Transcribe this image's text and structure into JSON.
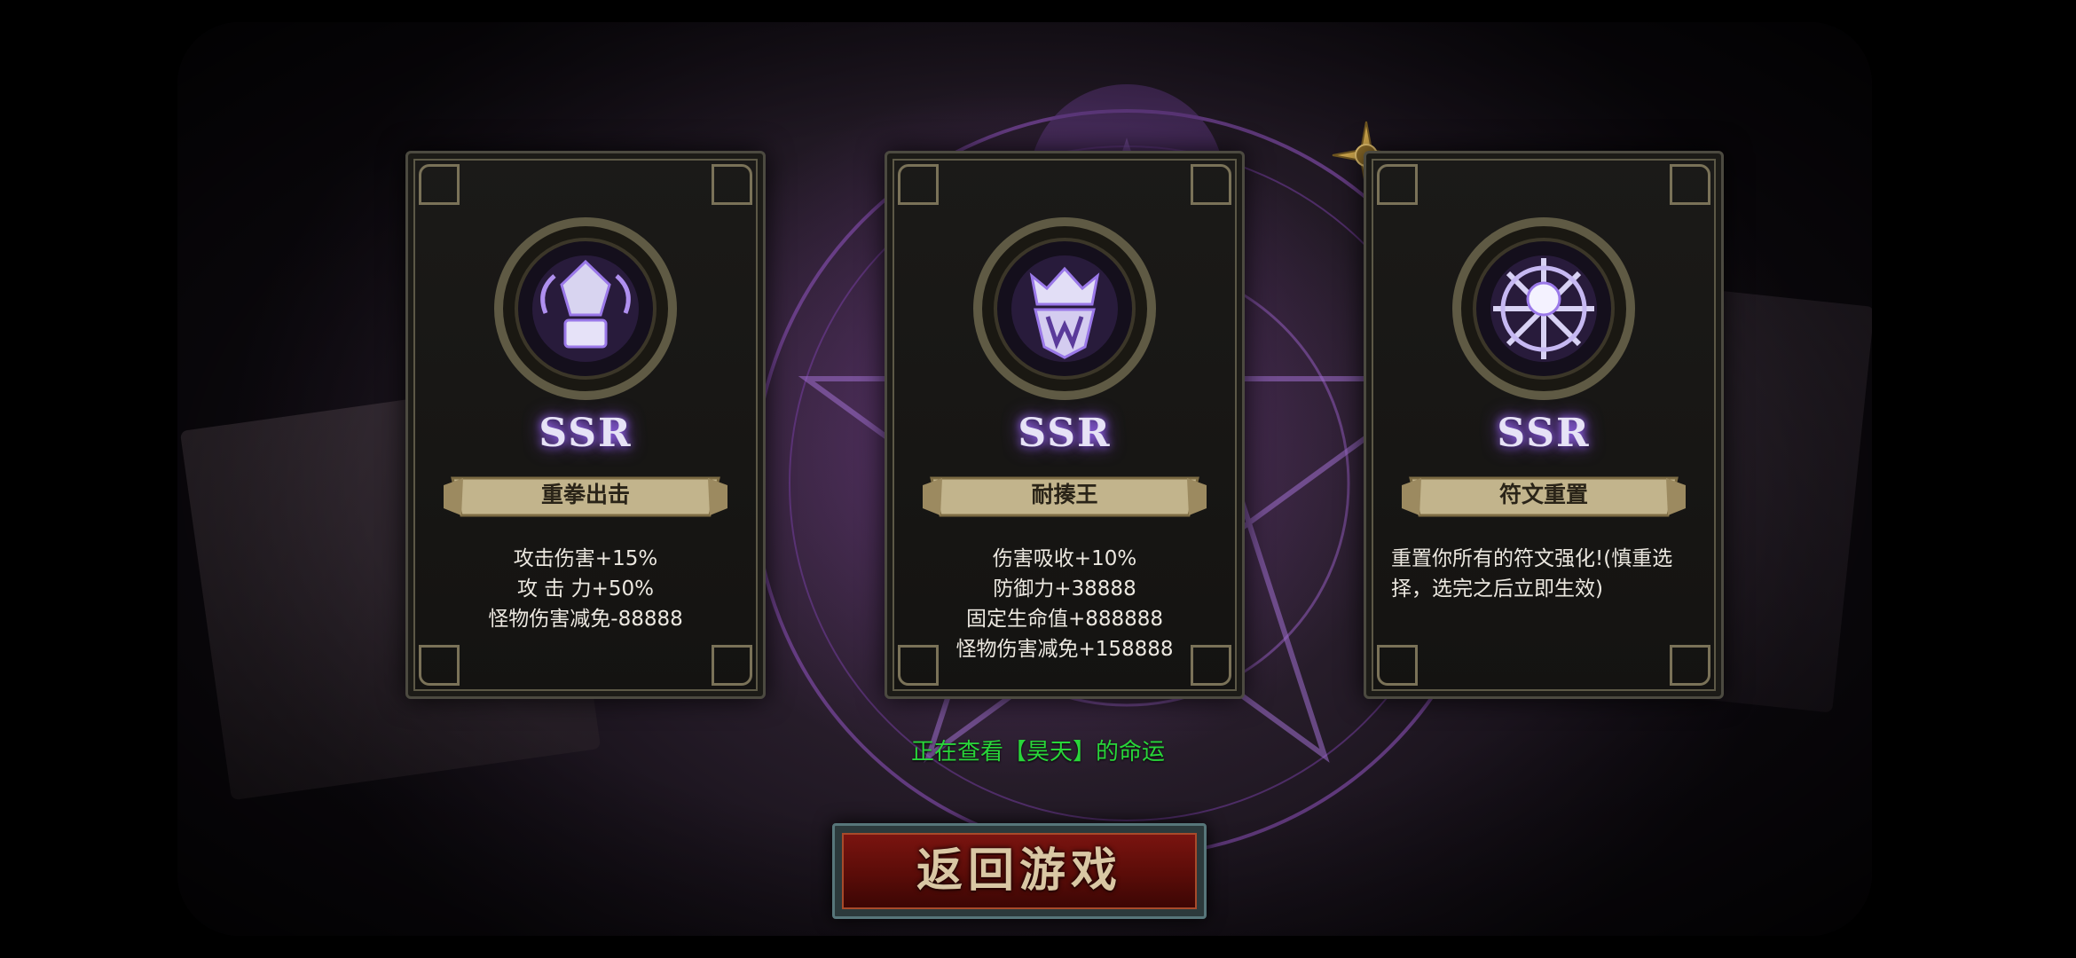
{
  "cards": [
    {
      "rarity": "SSR",
      "name": "重拳出击",
      "icon": "fist-rune-icon",
      "stats": [
        "攻击伤害+15%",
        "攻 击 力+50%",
        "怪物伤害减免-88888"
      ]
    },
    {
      "rarity": "SSR",
      "name": "耐揍王",
      "icon": "crown-shield-rune-icon",
      "stats": [
        "伤害吸收+10%",
        "防御力+38888",
        "固定生命值+888888",
        "怪物伤害减免+158888"
      ]
    },
    {
      "rarity": "SSR",
      "name": "符文重置",
      "icon": "sun-wheel-rune-icon",
      "stats": [
        "重置你所有的符文强化!(慎重选",
        "择，选完之后立即生效)"
      ]
    }
  ],
  "status_text": "正在查看【昊天】的命运",
  "back_button_label": "返回游戏",
  "colors": {
    "status_green": "#29d63a",
    "rarity_glow": "#a070ff",
    "button_red": "#7a1410"
  }
}
